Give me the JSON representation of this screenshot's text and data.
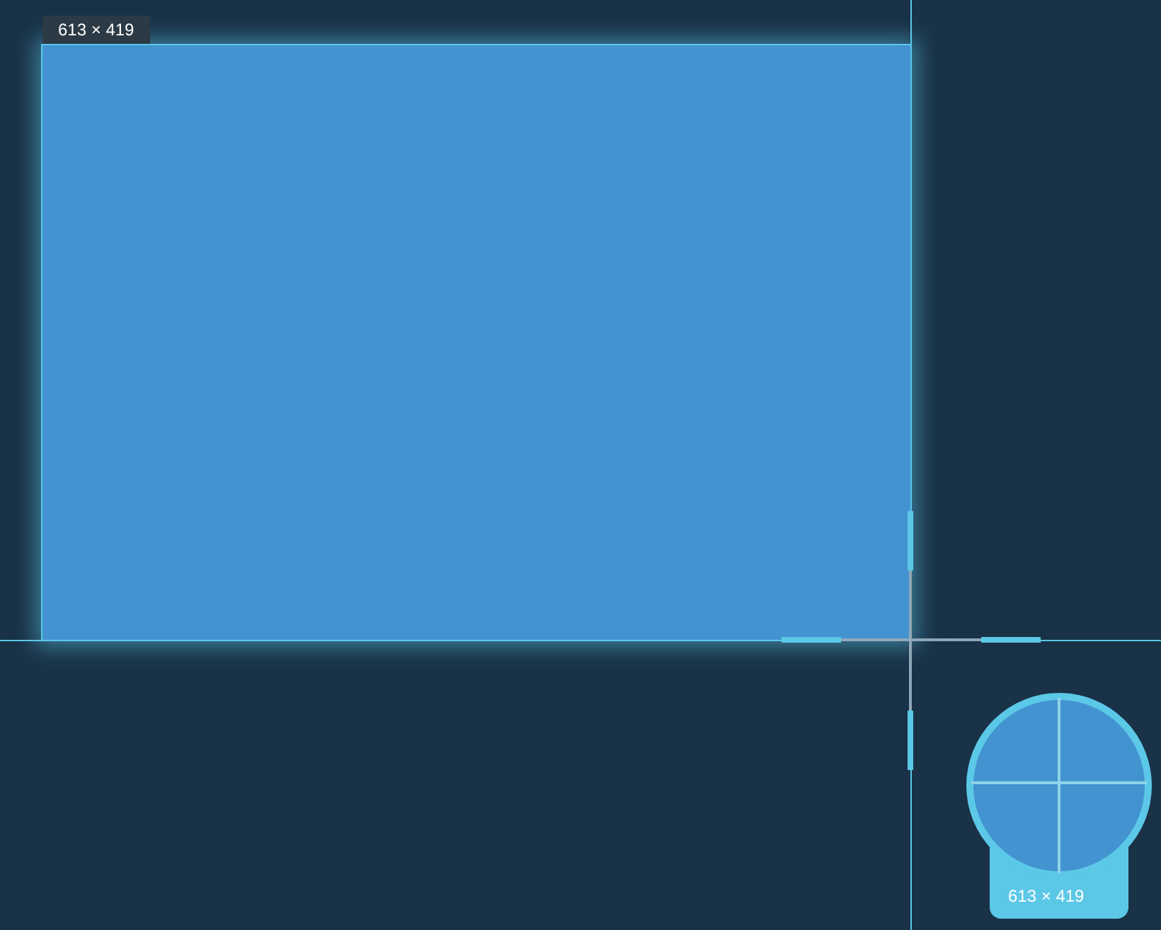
{
  "selection": {
    "size_label": "613 × 419"
  },
  "magnifier": {
    "size_label": "613 × 419"
  }
}
